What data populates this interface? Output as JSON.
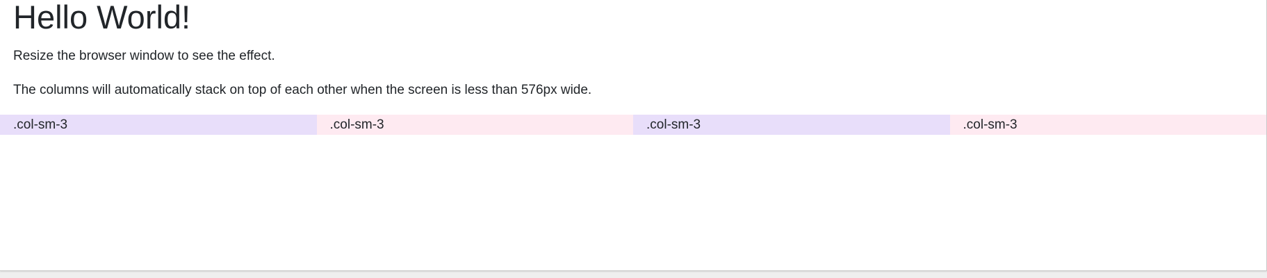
{
  "page": {
    "title": "Hello World!",
    "paragraphs": [
      "Resize the browser window to see the effect.",
      "The columns will automatically stack on top of each other when the screen is less than 576px wide."
    ]
  },
  "row": {
    "columns": [
      {
        "label": ".col-sm-3",
        "color": "#e8defa"
      },
      {
        "label": ".col-sm-3",
        "color": "#feeaf1"
      },
      {
        "label": ".col-sm-3",
        "color": "#e8defa"
      },
      {
        "label": ".col-sm-3",
        "color": "#feeaf1"
      }
    ]
  }
}
